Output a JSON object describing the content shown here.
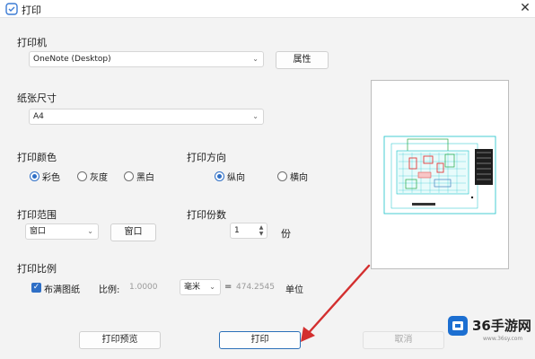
{
  "window": {
    "title": "打印",
    "close_glyph": "✕"
  },
  "printer": {
    "section_label": "打印机",
    "selected": "OneNote (Desktop)",
    "properties_button": "属性"
  },
  "paper": {
    "section_label": "纸张尺寸",
    "selected": "A4"
  },
  "color": {
    "section_label": "打印颜色",
    "options": [
      {
        "label": "彩色",
        "selected": true
      },
      {
        "label": "灰度",
        "selected": false
      },
      {
        "label": "黑白",
        "selected": false
      }
    ]
  },
  "orientation": {
    "section_label": "打印方向",
    "options": [
      {
        "label": "纵向",
        "selected": true
      },
      {
        "label": "横向",
        "selected": false
      }
    ]
  },
  "range": {
    "section_label": "打印范围",
    "selected": "窗口",
    "window_button": "窗口"
  },
  "copies": {
    "section_label": "打印份数",
    "value": "1",
    "unit": "份"
  },
  "scale": {
    "section_label": "打印比例",
    "fit_label": "布满图纸",
    "fit_checked": true,
    "ratio_label": "比例:",
    "ratio_value": "1.0000",
    "unit_select": "毫米",
    "equals": "=",
    "computed_value": "474.2545",
    "unit_label": "单位"
  },
  "buttons": {
    "preview": "打印预览",
    "print": "打印",
    "cancel": "取消"
  },
  "watermark": {
    "brand": "36手游网",
    "url": "www.36sy.com"
  },
  "colors": {
    "accent": "#2f6fc6",
    "arrow": "#d32f2f",
    "drawing_cyan": "#19c2c9",
    "drawing_green": "#22a845",
    "drawing_red": "#e23a3a"
  }
}
